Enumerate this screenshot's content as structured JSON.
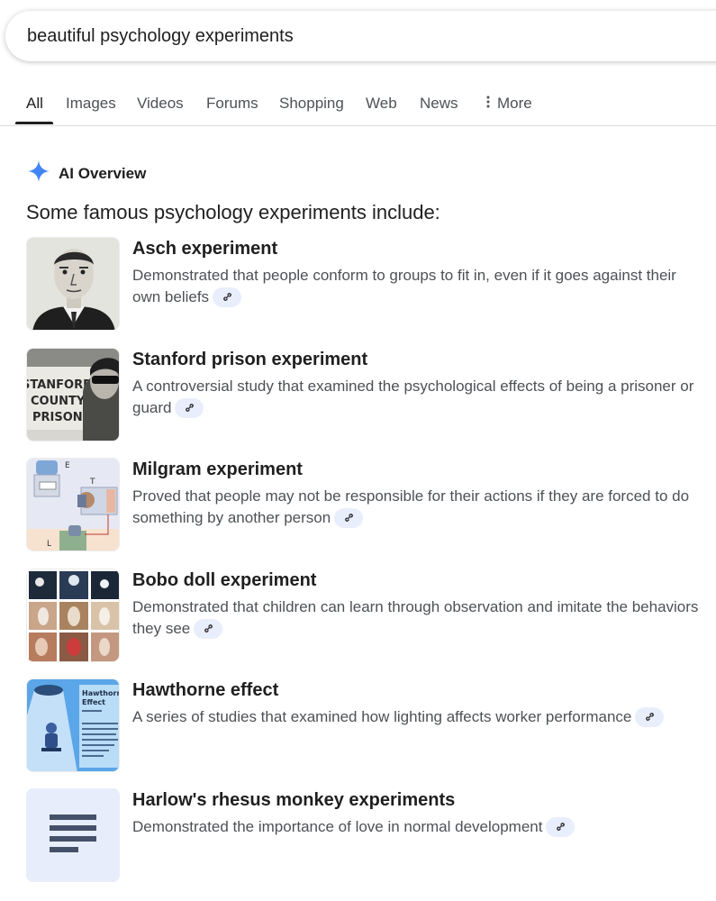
{
  "search": {
    "query": "beautiful psychology experiments"
  },
  "tabs": [
    {
      "label": "All",
      "active": true
    },
    {
      "label": "Images"
    },
    {
      "label": "Videos"
    },
    {
      "label": "Forums"
    },
    {
      "label": "Shopping"
    },
    {
      "label": "Web"
    },
    {
      "label": "News"
    },
    {
      "label": "More",
      "icon": "more-vert-icon"
    }
  ],
  "ai_overview": {
    "label": "AI Overview",
    "icon": "gemini-sparkle-icon",
    "accent": "#4285f4",
    "intro": "Some famous psychology experiments include:",
    "items": [
      {
        "title": "Asch experiment",
        "description": "Demonstrated that people conform to groups to fit in, even if it goes against their own beliefs",
        "thumbnail": "portrait-illustration"
      },
      {
        "title": "Stanford prison experiment",
        "description": "A controversial study that examined the psychological effects of being a prisoner or guard",
        "thumbnail": "stanford-county-prison-photo",
        "thumbnail_text": [
          "STANFORD",
          "COUNTY",
          "PRISON"
        ]
      },
      {
        "title": "Milgram experiment",
        "description": "Proved that people may not be responsible for their actions if they are forced to do something by another person",
        "thumbnail": "milgram-diagram",
        "thumbnail_text": [
          "E",
          "T",
          "L"
        ]
      },
      {
        "title": "Bobo doll experiment",
        "description": "Demonstrated that children can learn through observation and imitate the behaviors they see",
        "thumbnail": "photo-grid"
      },
      {
        "title": "Hawthorne effect",
        "description": "A series of studies that examined how lighting affects worker performance",
        "thumbnail": "hawthorne-effect-card",
        "thumbnail_text": [
          "Hawthorne",
          "Effect"
        ]
      },
      {
        "title": "Harlow's rhesus monkey experiments",
        "description": "Demonstrated the importance of love in normal development",
        "thumbnail": "document-placeholder-icon"
      }
    ]
  }
}
